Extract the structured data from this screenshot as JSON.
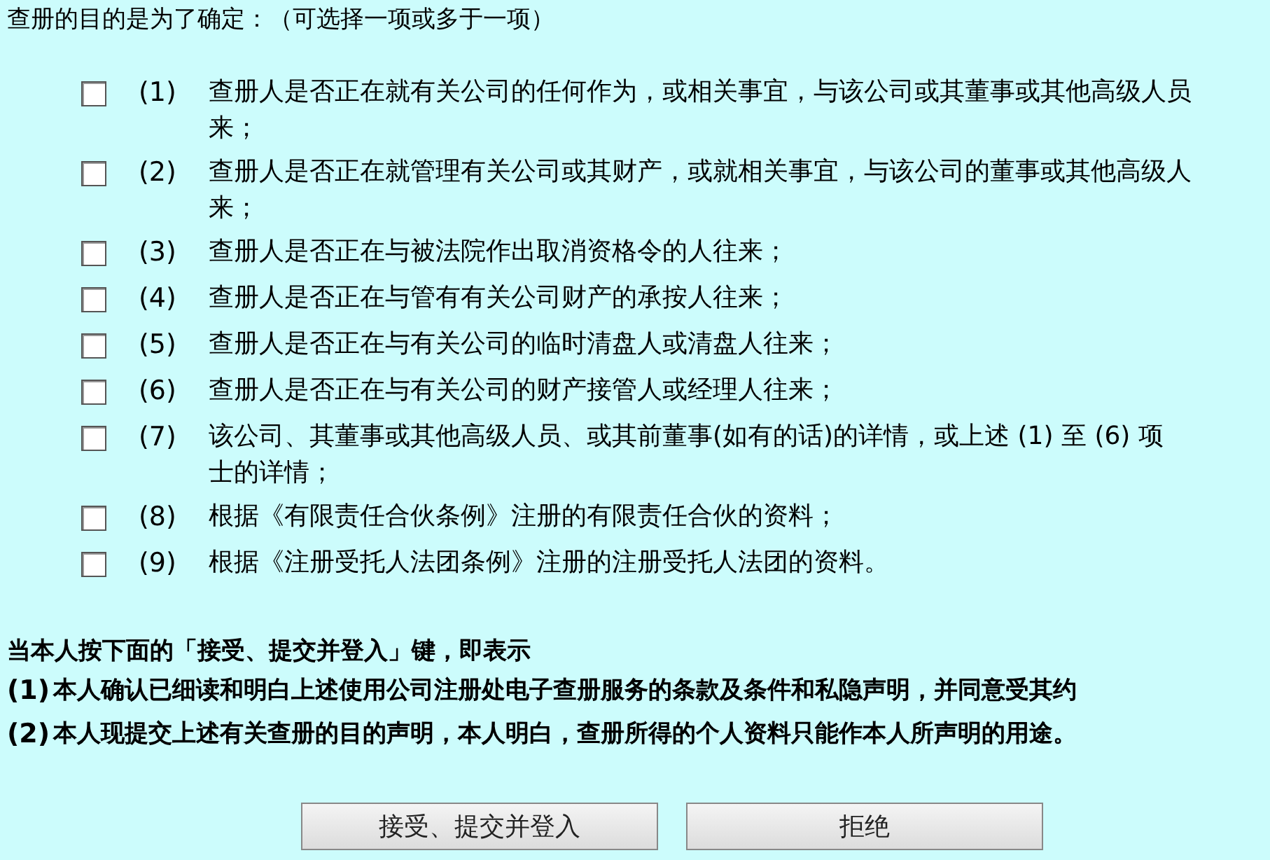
{
  "heading": "查册的目的是为了确定：（可选择一项或多于一项）",
  "options": [
    {
      "number": "(1)",
      "lines": [
        "查册人是否正在就有关公司的任何作为，或相关事宜，与该公司或其董事或其他高级人员",
        "来；"
      ],
      "checked": false
    },
    {
      "number": "(2)",
      "lines": [
        "查册人是否正在就管理有关公司或其财产，或就相关事宜，与该公司的董事或其他高级人",
        "来；"
      ],
      "checked": false
    },
    {
      "number": "(3)",
      "lines": [
        "查册人是否正在与被法院作出取消资格令的人往来；"
      ],
      "checked": false
    },
    {
      "number": "(4)",
      "lines": [
        "查册人是否正在与管有有关公司财产的承按人往来；"
      ],
      "checked": false
    },
    {
      "number": "(5)",
      "lines": [
        "查册人是否正在与有关公司的临时清盘人或清盘人往来；"
      ],
      "checked": false
    },
    {
      "number": "(6)",
      "lines": [
        "查册人是否正在与有关公司的财产接管人或经理人往来；"
      ],
      "checked": false
    },
    {
      "number": "(7)",
      "lines": [
        "该公司、其董事或其他高级人员、或其前董事(如有的话)的详情，或上述 (1) 至 (6) 项",
        "士的详情；"
      ],
      "checked": false
    },
    {
      "number": "(8)",
      "lines": [
        "根据《有限责任合伙条例》注册的有限责任合伙的资料；"
      ],
      "checked": false
    },
    {
      "number": "(9)",
      "lines": [
        "根据《注册受托人法团条例》注册的注册受托人法团的资料。"
      ],
      "checked": false
    }
  ],
  "declaration": {
    "intro": "当本人按下面的「接受、提交并登入」键，即表示",
    "items": [
      {
        "number": "(1)",
        "text": "本人确认已细读和明白上述使用公司注册处电子查册服务的条款及条件和私隐声明，并同意受其约"
      },
      {
        "number": "(2)",
        "text": "本人现提交上述有关查册的目的声明，本人明白，查册所得的个人资料只能作本人所声明的用途。"
      }
    ]
  },
  "buttons": [
    "接受、提交并登入",
    "拒绝"
  ]
}
